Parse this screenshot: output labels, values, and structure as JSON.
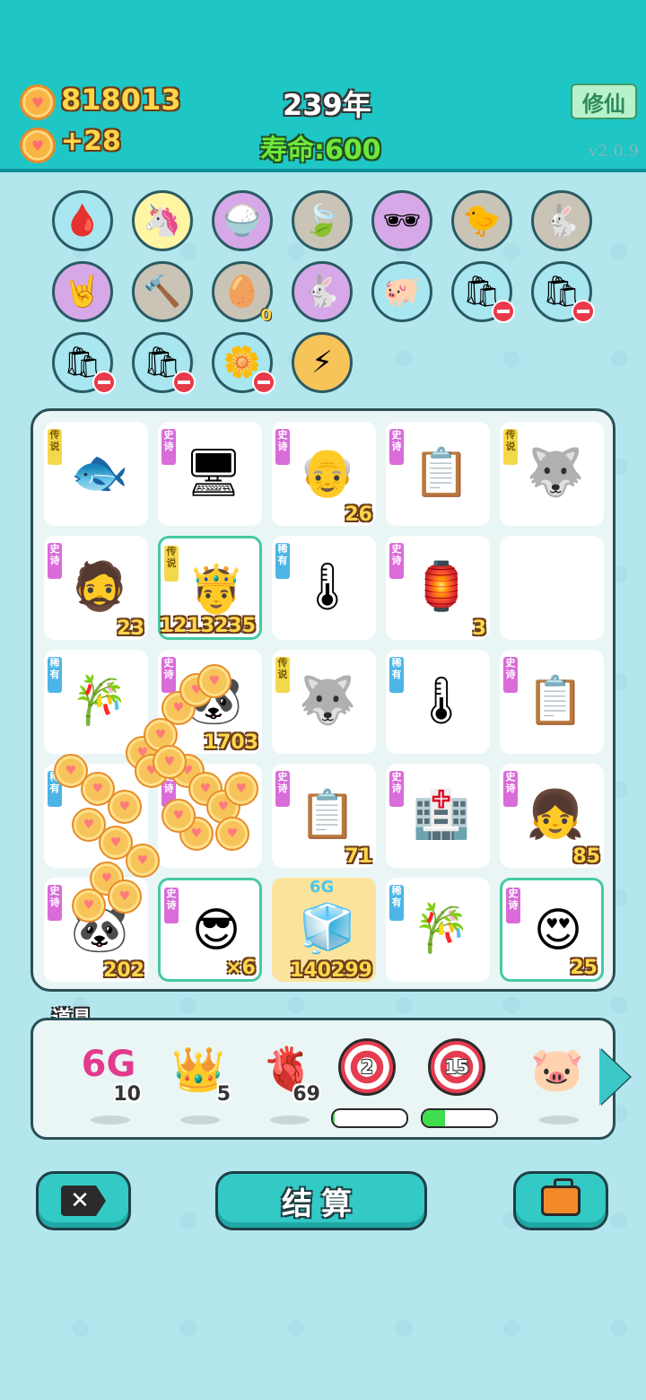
{
  "header": {
    "coins": "818013",
    "coin_rate": "+28",
    "year": "239年",
    "lifespan_label": "寿命:",
    "lifespan_value": "600",
    "cultivate_button": "修仙",
    "version": "v2.0.9"
  },
  "inventory_icons": [
    {
      "name": "blood-bag-icon",
      "glyph": "🩸",
      "bg": "#a8e6f0"
    },
    {
      "name": "unicorn-icon",
      "glyph": "🦄",
      "bg": "#fff5a3",
      "heart": true
    },
    {
      "name": "rice-bowl-icon",
      "glyph": "🍚",
      "bg": "#d7a8e8",
      "heart": true
    },
    {
      "name": "leaf-icon",
      "glyph": "🍃",
      "bg": "#c9c4b6",
      "heart": true
    },
    {
      "name": "sunglasses-icon",
      "glyph": "🕶",
      "bg": "#d7a8e8"
    },
    {
      "name": "chick-icon",
      "glyph": "🐤",
      "bg": "#c9c4b6"
    },
    {
      "name": "rabbit-icon",
      "glyph": "🐇",
      "bg": "#c9c4b6",
      "heart": true
    },
    {
      "name": "rock-hand-icon",
      "glyph": "🤘",
      "bg": "#d7a8e8"
    },
    {
      "name": "hammer-icon",
      "glyph": "🔨",
      "bg": "#c9c4b6"
    },
    {
      "name": "egg-tray-icon",
      "glyph": "🥚",
      "bg": "#c9c4b6",
      "zero": "0"
    },
    {
      "name": "rabbit-icon",
      "glyph": "🐇",
      "bg": "#d7a8e8",
      "heart": true
    },
    {
      "name": "piggy-bank-icon",
      "glyph": "🐖",
      "bg": "#a8e6f0"
    },
    {
      "name": "sack-icon",
      "glyph": "🛍",
      "bg": "#a8e6f0",
      "minus": true
    },
    {
      "name": "sack-icon",
      "glyph": "🛍",
      "bg": "#a8e6f0",
      "minus": true
    },
    {
      "name": "sack-icon",
      "glyph": "🛍",
      "bg": "#a8e6f0",
      "minus": true
    },
    {
      "name": "sack-icon",
      "glyph": "🛍",
      "bg": "#a8e6f0",
      "minus": true
    },
    {
      "name": "flower-pot-icon",
      "glyph": "🌼",
      "bg": "#a8e6f0",
      "minus": true
    },
    {
      "name": "lightning-icon",
      "glyph": "⚡",
      "bg": "#f7c45a"
    }
  ],
  "tag_labels": {
    "legend": "传说",
    "epic": "史诗",
    "rare": "稀有"
  },
  "board": [
    {
      "tag": "legend",
      "tagc": "y",
      "glyph": "🐟",
      "name": "koi-fish"
    },
    {
      "tag": "epic",
      "tagc": "p",
      "glyph": "🖥",
      "name": "graphics-card"
    },
    {
      "tag": "epic",
      "tagc": "p",
      "glyph": "👴",
      "name": "old-man-face",
      "count": "26"
    },
    {
      "tag": "epic",
      "tagc": "p",
      "glyph": "📋",
      "name": "ctrl-c-ctrl-v"
    },
    {
      "tag": "legend",
      "tagc": "y",
      "glyph": "🐺",
      "name": "husky-king"
    },
    {
      "tag": "epic",
      "tagc": "p",
      "glyph": "🧔",
      "name": "bearded-man",
      "count": "23"
    },
    {
      "tag": "legend",
      "tagc": "y",
      "glyph": "🤴",
      "name": "rich-king",
      "count": "1213235",
      "hl": true
    },
    {
      "tag": "rare",
      "tagc": "b",
      "glyph": "🌡",
      "name": "gauge"
    },
    {
      "tag": "epic",
      "tagc": "p",
      "glyph": "🏮",
      "name": "rabbit-lantern",
      "count": "3"
    },
    {
      "empty": true
    },
    {
      "tag": "rare",
      "tagc": "b",
      "glyph": "🎋",
      "name": "bamboo"
    },
    {
      "tag": "epic",
      "tagc": "p",
      "glyph": "🐼",
      "name": "panda",
      "count": "1703"
    },
    {
      "tag": "legend",
      "tagc": "y",
      "glyph": "🐺",
      "name": "husky-king"
    },
    {
      "tag": "rare",
      "tagc": "b",
      "glyph": "🌡",
      "name": "gauge"
    },
    {
      "tag": "epic",
      "tagc": "p",
      "glyph": "📋",
      "name": "ctrl-c-ctrl-v"
    },
    {
      "tag": "rare",
      "tagc": "b",
      "glyph": "",
      "name": "hidden-item"
    },
    {
      "tag": "epic",
      "tagc": "p",
      "glyph": "",
      "name": "hidden-item"
    },
    {
      "tag": "epic",
      "tagc": "p",
      "glyph": "📋",
      "name": "ctrl-c-ctrl-v",
      "count": "71"
    },
    {
      "tag": "epic",
      "tagc": "p",
      "glyph": "🏥",
      "name": "icu-sign"
    },
    {
      "tag": "epic",
      "tagc": "p",
      "glyph": "👧",
      "name": "girl-portrait",
      "count": "85"
    },
    {
      "tag": "epic",
      "tagc": "p",
      "glyph": "🐼",
      "name": "panda",
      "count": "202"
    },
    {
      "tag": "epic",
      "tagc": "p",
      "glyph": "😎",
      "name": "cool-guy",
      "count": "×6",
      "hl": true
    },
    {
      "glyph": "🧊",
      "name": "fridge-6g",
      "count": "140299",
      "gold": true,
      "label": "6G"
    },
    {
      "tag": "rare",
      "tagc": "b",
      "glyph": "🎋",
      "name": "bamboo"
    },
    {
      "tag": "epic",
      "tagc": "p",
      "glyph": "😍",
      "name": "heart-eyes-face",
      "count": "25",
      "hl": true
    }
  ],
  "tools_title": "道具",
  "tools": [
    {
      "name": "6g-tool",
      "glyph": "6G",
      "count": "10"
    },
    {
      "name": "crown-tool",
      "glyph": "👑",
      "count": "5"
    },
    {
      "name": "liver-tool",
      "glyph": "🫀",
      "count": "69"
    },
    {
      "name": "target-tool",
      "value": "2",
      "progress": 0.02
    },
    {
      "name": "target-tool",
      "value": "15",
      "progress": 0.3
    },
    {
      "name": "piggy-tool",
      "glyph": "🐷"
    }
  ],
  "buttons": {
    "settle": "结算",
    "close_glyph": "✕"
  },
  "colors": {
    "header": "#1ec6c6",
    "accent": "#33c9c4",
    "coin": "#ffd64a"
  }
}
